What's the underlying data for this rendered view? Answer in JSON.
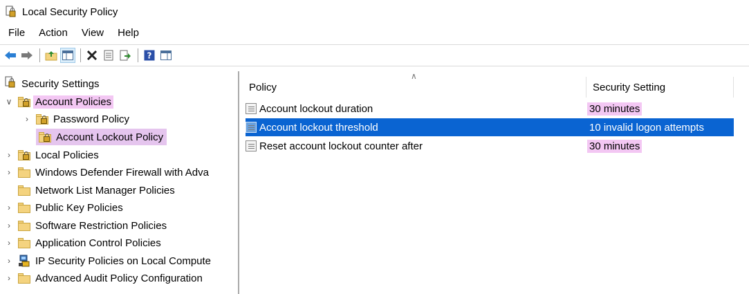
{
  "window": {
    "title": "Local Security Policy",
    "icon": "security-policy-app-icon"
  },
  "menu": [
    "File",
    "Action",
    "View",
    "Help"
  ],
  "toolbar": {
    "buttons": [
      "back-arrow-icon",
      "forward-arrow-icon",
      "up-folder-icon",
      "show-hide-console-tree-icon",
      "delete-icon",
      "properties-icon",
      "export-list-icon",
      "help-icon",
      "show-action-pane-icon"
    ]
  },
  "tree": {
    "root": "Security Settings",
    "account_policies": "Account Policies",
    "password_policy": "Password Policy",
    "account_lockout_policy": "Account Lockout Policy",
    "local_policies": "Local Policies",
    "firewall": "Windows Defender Firewall with Adva",
    "network_list": "Network List Manager Policies",
    "public_key": "Public Key Policies",
    "software_restriction": "Software Restriction Policies",
    "application_control": "Application Control Policies",
    "ip_security": "IP Security Policies on Local Compute",
    "advanced_audit": "Advanced Audit Policy Configuration"
  },
  "list": {
    "columns": {
      "policy": "Policy",
      "setting": "Security Setting"
    },
    "rows": [
      {
        "policy": "Account lockout duration",
        "setting": "30 minutes"
      },
      {
        "policy": "Account lockout threshold",
        "setting": "10 invalid logon attempts"
      },
      {
        "policy": "Reset account lockout counter after",
        "setting": "30 minutes"
      }
    ]
  },
  "colors": {
    "selection": "#0a64d2",
    "highlight": "#f3c7f3"
  }
}
